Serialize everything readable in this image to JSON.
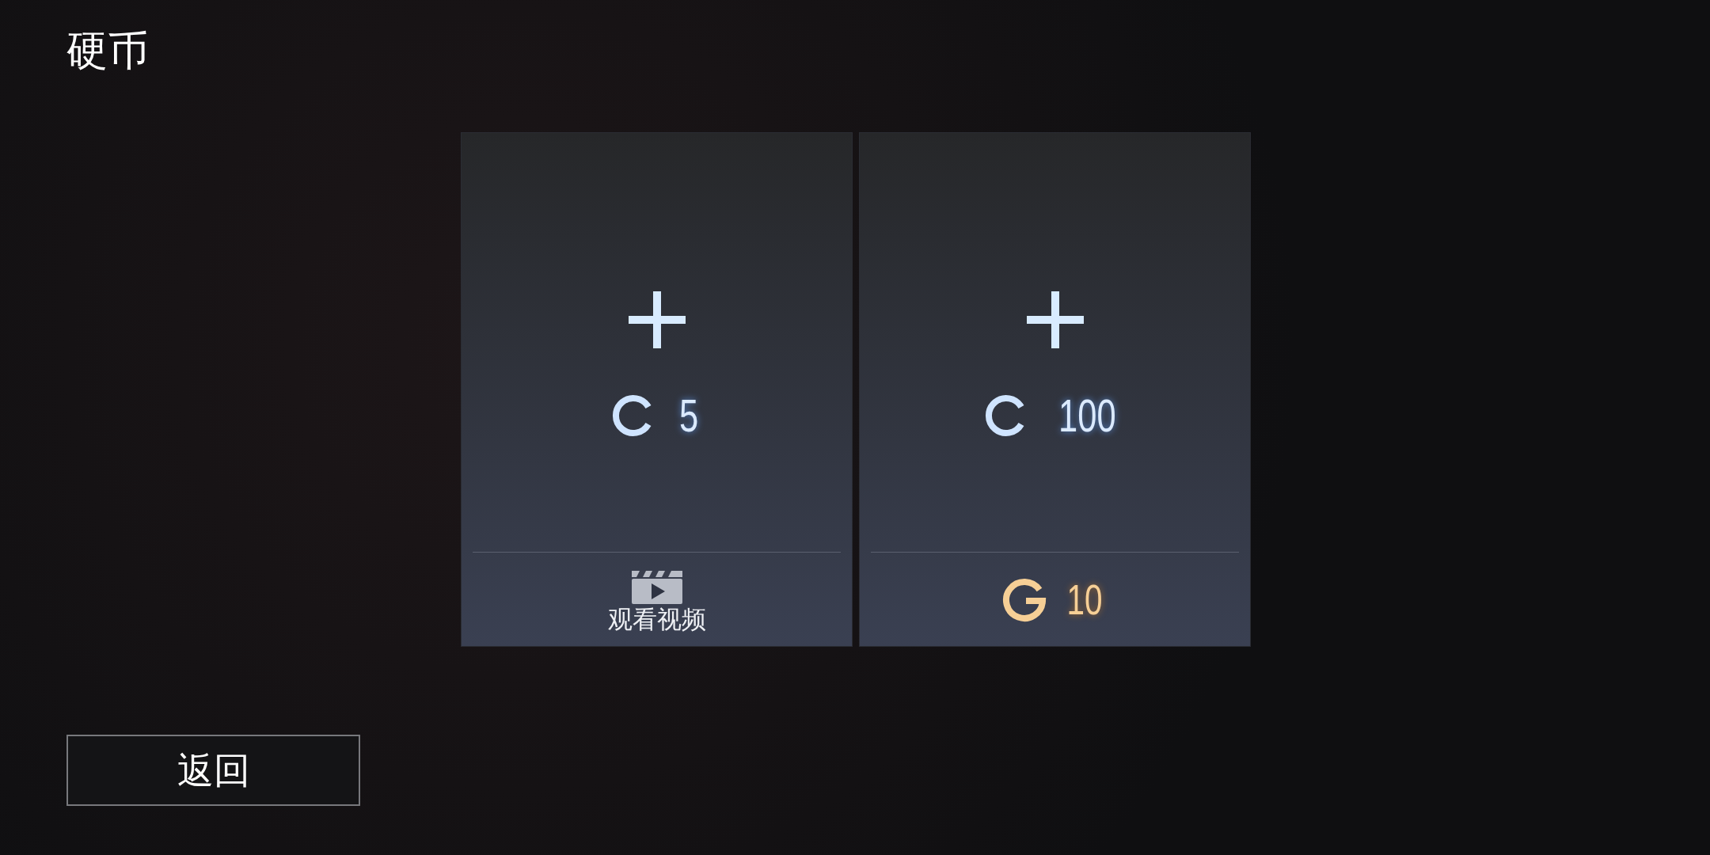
{
  "title": "硬币",
  "offers": [
    {
      "kind": "video",
      "amount": "5",
      "label": "观看视频"
    },
    {
      "kind": "price",
      "amount": "100",
      "price": "10"
    }
  ],
  "back_button": "返回"
}
